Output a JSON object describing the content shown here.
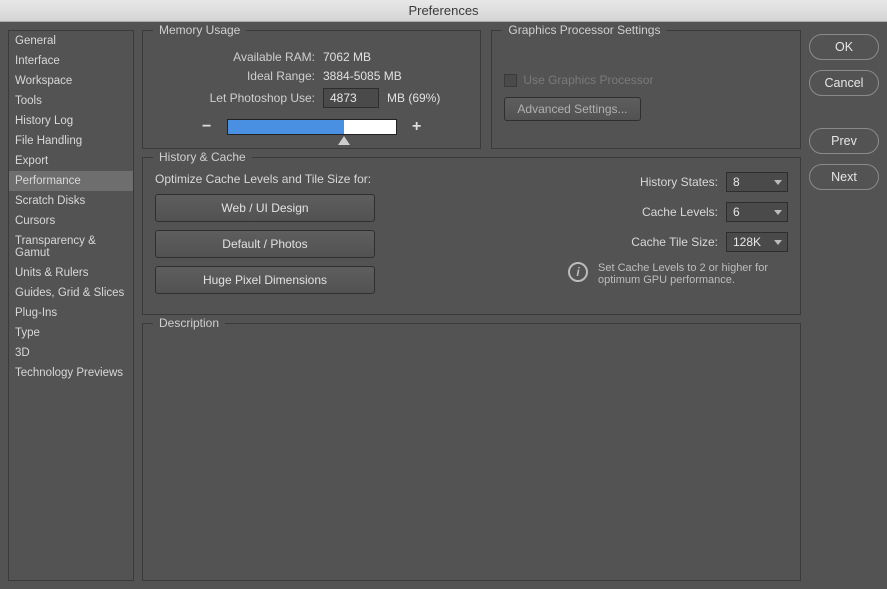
{
  "title": "Preferences",
  "sidebar": {
    "items": [
      "General",
      "Interface",
      "Workspace",
      "Tools",
      "History Log",
      "File Handling",
      "Export",
      "Performance",
      "Scratch Disks",
      "Cursors",
      "Transparency & Gamut",
      "Units & Rulers",
      "Guides, Grid & Slices",
      "Plug-Ins",
      "Type",
      "3D",
      "Technology Previews"
    ],
    "selected_index": 7
  },
  "memory": {
    "legend": "Memory Usage",
    "available_label": "Available RAM:",
    "available_value": "7062 MB",
    "ideal_label": "Ideal Range:",
    "ideal_value": "3884-5085 MB",
    "use_label": "Let Photoshop Use:",
    "use_value": "4873",
    "use_suffix": "MB (69%)",
    "minus": "−",
    "plus": "+"
  },
  "gpu": {
    "legend": "Graphics Processor Settings",
    "checkbox_label": "Use Graphics Processor",
    "advanced_btn": "Advanced Settings..."
  },
  "history": {
    "legend": "History & Cache",
    "hint": "Optimize Cache Levels and Tile Size for:",
    "opt1": "Web / UI Design",
    "opt2": "Default / Photos",
    "opt3": "Huge Pixel Dimensions",
    "states_label": "History States:",
    "states_value": "8",
    "levels_label": "Cache Levels:",
    "levels_value": "6",
    "tile_label": "Cache Tile Size:",
    "tile_value": "128K",
    "info": "Set Cache Levels to 2 or higher for optimum GPU performance.",
    "info_i": "i"
  },
  "description": {
    "legend": "Description"
  },
  "buttons": {
    "ok": "OK",
    "cancel": "Cancel",
    "prev": "Prev",
    "next": "Next"
  }
}
